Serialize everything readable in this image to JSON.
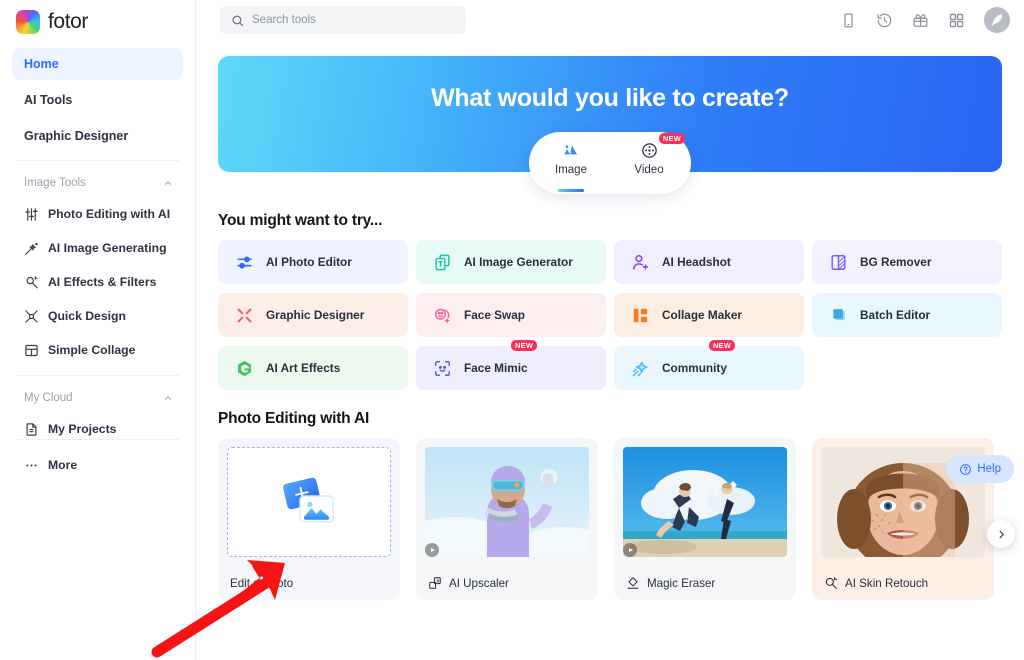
{
  "brand": {
    "name": "fotor",
    "logo_icon": "fotor-logo-icon"
  },
  "sidebar": {
    "primary": [
      {
        "label": "Home",
        "active": true
      },
      {
        "label": "AI Tools",
        "active": false
      },
      {
        "label": "Graphic Designer",
        "active": false
      }
    ],
    "groups": [
      {
        "title": "Image Tools",
        "collapse_icon": "chevron-up-icon",
        "items": [
          {
            "label": "Photo Editing with AI",
            "icon": "sliders-icon"
          },
          {
            "label": "AI Image Generating",
            "icon": "sparkle-wand-icon"
          },
          {
            "label": "AI Effects & Filters",
            "icon": "magic-effects-icon"
          },
          {
            "label": "Quick Design",
            "icon": "quick-design-icon"
          },
          {
            "label": "Simple Collage",
            "icon": "collage-layout-icon"
          }
        ]
      },
      {
        "title": "My Cloud",
        "collapse_icon": "chevron-up-icon",
        "items": [
          {
            "label": "My Projects",
            "icon": "document-icon"
          }
        ]
      }
    ],
    "more": {
      "label": "More",
      "icon": "ellipsis-icon"
    }
  },
  "topbar": {
    "search": {
      "placeholder": "Search tools",
      "value": "",
      "icon": "search-icon"
    },
    "icons": [
      {
        "name": "mobile-app-icon"
      },
      {
        "name": "history-icon"
      },
      {
        "name": "gift-icon"
      },
      {
        "name": "apps-grid-icon"
      }
    ],
    "avatar": {
      "name": "user-avatar",
      "icon": "feather-avatar-icon"
    }
  },
  "hero": {
    "title": "What would you like to create?",
    "gradient_from": "#5fd9f8",
    "gradient_to": "#2a63f4",
    "tabs": [
      {
        "label": "Image",
        "icon": "mountain-image-icon",
        "selected": true,
        "badge": ""
      },
      {
        "label": "Video",
        "icon": "film-reel-icon",
        "selected": false,
        "badge": "NEW"
      }
    ]
  },
  "try_section": {
    "title": "You might want to try...",
    "tiles": [
      {
        "label": "AI Photo Editor",
        "icon": "sliders-icon",
        "bg": "#eef3ff",
        "accent": "#2f6bff",
        "badge": ""
      },
      {
        "label": "AI Image Generator",
        "icon": "image-stack-icon",
        "bg": "#e8faf5",
        "accent": "#14c7a6",
        "badge": ""
      },
      {
        "label": "AI Headshot",
        "icon": "person-plus-icon",
        "bg": "#f2eefe",
        "accent": "#8b3ff0",
        "badge": ""
      },
      {
        "label": "BG Remover",
        "icon": "bg-remove-icon",
        "bg": "#f4f1fe",
        "accent": "#7a5bf0",
        "badge": ""
      },
      {
        "label": "Graphic Designer",
        "icon": "crossed-tools-icon",
        "bg": "#fdeee8",
        "accent": "#f2586e",
        "badge": ""
      },
      {
        "label": "Face Swap",
        "icon": "face-swap-icon",
        "bg": "#fdeef0",
        "accent": "#fb5c9b",
        "badge": ""
      },
      {
        "label": "Collage Maker",
        "icon": "collage-blocks-icon",
        "bg": "#fdeee1",
        "accent": "#f97a25",
        "badge": ""
      },
      {
        "label": "Batch Editor",
        "icon": "batch-layers-icon",
        "bg": "#e6f8fd",
        "accent": "#2fb4e3",
        "badge": ""
      },
      {
        "label": "AI Art Effects",
        "icon": "gem-icon",
        "bg": "#edf8ee",
        "accent": "#3fc463",
        "badge": ""
      },
      {
        "label": "Face Mimic",
        "icon": "face-scan-icon",
        "bg": "#eeeefc",
        "accent": "#5b5bd6",
        "badge": "NEW"
      },
      {
        "label": "Community",
        "icon": "shooting-star-icon",
        "bg": "#e9f7fd",
        "accent": "#46b6f9",
        "badge": "NEW"
      }
    ]
  },
  "photo_section": {
    "title": "Photo Editing with AI",
    "next_icon": "chevron-right-icon",
    "cards": [
      {
        "label": "Edit a Photo",
        "icon": "",
        "type": "dropzone",
        "media_icon": "add-photo-icon",
        "has_play": false
      },
      {
        "label": "AI Upscaler",
        "icon": "upscale-icon",
        "type": "photo",
        "media_icon": "skier-photo",
        "has_play": true
      },
      {
        "label": "Magic Eraser",
        "icon": "eraser-icon",
        "type": "photo",
        "media_icon": "jumping-people-photo",
        "has_play": true
      },
      {
        "label": "AI Skin Retouch",
        "icon": "skin-retouch-icon",
        "type": "photo",
        "media_icon": "woman-face-photo",
        "has_play": false
      }
    ]
  },
  "help": {
    "label": "Help",
    "icon": "question-circle-icon"
  },
  "annotation": {
    "arrow": "red-pointer-arrow",
    "color": "#f51414"
  }
}
